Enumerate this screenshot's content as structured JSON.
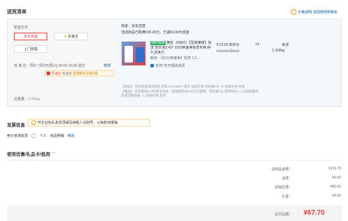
{
  "header": {
    "title": "送货清单",
    "price_help": "价格说明",
    "return_to_cart": "返回修改购物车"
  },
  "delivery": {
    "method_label": "配送方式",
    "options": [
      "京东快递",
      "京准达",
      "上门自提"
    ],
    "time_label": "标 准 达：",
    "time_text": "预计 7月5日[周六] 09:00-15:00 送达",
    "modify": "修改",
    "service_badge": "京准达",
    "service_extra": "标准达",
    "upgrade": "配送服务全面升级",
    "weight_label": "总重量：",
    "weight_value": "3.960kg"
  },
  "store": {
    "name": "商家：京东自营",
    "promo": "活动商品已购满109.00元，已减50.00元现金"
  },
  "product": {
    "tag": "限时特惠",
    "title": "奥妙（OMO）【至高推荐】快洗 洗衣液2.4斤 15分钟速净快洗专用 持久洁净力",
    "color_label": "颜色：【15分钟速净】快洗 1.2...",
    "return_service": "支持7天无理由退货",
    "price": "¥ 22.56 到手价",
    "orig_price": "¥ 39.90 原价价",
    "qty": "x3",
    "stock": "有货",
    "weight": "1.320kg"
  },
  "gifts": {
    "line1": "【赠品】 京东快速洗衣服务 轿车/SUV/MPV 单次 全国可用 有效期7天 ×1  查看价格  有货",
    "line2": "【赠品】 京东家政2小时保洁体验（金额限制满300元可使用）有效期7天 使用时段 ×1 已赠送服务",
    "line3": "区域范围查看 ×1  查看价格  有货"
  },
  "invoice": {
    "title": "发票信息",
    "notice": "开企业抬头发票须填写纳税人识别号，以免影响报销",
    "type": "电子普通发票",
    "personal": "个人",
    "detail": "商品明细",
    "modify": "修改"
  },
  "coupon": {
    "title": "使用优惠/礼品卡/抵用"
  },
  "summary": {
    "rows": [
      {
        "label": "总商品金额：",
        "value": "¥119.70"
      },
      {
        "label": "运费：",
        "value": "¥0.00"
      },
      {
        "label": "促销优惠：",
        "value": "-¥50.00"
      },
      {
        "label": "礼金：",
        "value": "-¥2.00"
      }
    ],
    "total_label": "应付总额：",
    "total_value": "¥67.70"
  }
}
